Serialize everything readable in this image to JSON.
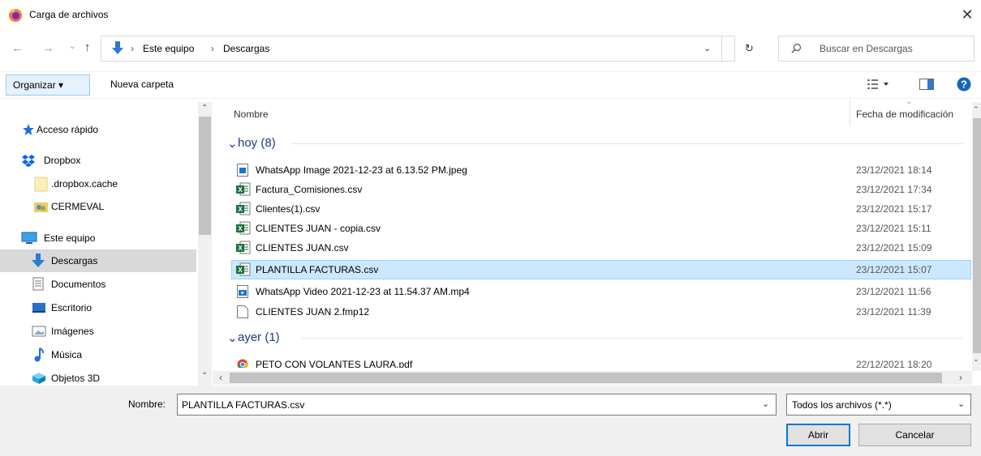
{
  "window": {
    "title": "Carga de archivos"
  },
  "address": {
    "parts": [
      "Este equipo",
      "Descargas"
    ]
  },
  "search": {
    "placeholder": "Buscar en Descargas"
  },
  "toolbar": {
    "organize_label": "Organizar ▾",
    "new_folder_label": "Nueva carpeta"
  },
  "sidebar": {
    "items": [
      {
        "label": "Acceso rápido",
        "icon": "star-icon"
      },
      {
        "label": "Dropbox",
        "icon": "dropbox-icon"
      },
      {
        "label": ".dropbox.cache",
        "icon": "folder-icon"
      },
      {
        "label": "CERMEVAL",
        "icon": "shared-folder-icon"
      },
      {
        "label": "Este equipo",
        "icon": "computer-icon"
      },
      {
        "label": "Descargas",
        "icon": "download-icon",
        "selected": true
      },
      {
        "label": "Documentos",
        "icon": "documents-icon"
      },
      {
        "label": "Escritorio",
        "icon": "desktop-icon"
      },
      {
        "label": "Imágenes",
        "icon": "images-icon"
      },
      {
        "label": "Música",
        "icon": "music-icon"
      },
      {
        "label": "Objetos 3D",
        "icon": "3d-objects-icon"
      }
    ]
  },
  "files": {
    "columns": {
      "name": "Nombre",
      "date": "Fecha de modificación"
    },
    "groups": [
      {
        "label": "hoy (8)",
        "items": [
          {
            "name": "WhatsApp Image 2021-12-23 at 6.13.52 PM.jpeg",
            "date": "23/12/2021 18:14",
            "icon": "image-file-icon"
          },
          {
            "name": "Factura_Comisiones.csv",
            "date": "23/12/2021 17:34",
            "icon": "csv-file-icon"
          },
          {
            "name": "Clientes(1).csv",
            "date": "23/12/2021 15:17",
            "icon": "csv-file-icon"
          },
          {
            "name": "CLIENTES JUAN - copia.csv",
            "date": "23/12/2021 15:11",
            "icon": "csv-file-icon"
          },
          {
            "name": "CLIENTES JUAN.csv",
            "date": "23/12/2021 15:09",
            "icon": "csv-file-icon"
          },
          {
            "name": "PLANTILLA FACTURAS.csv",
            "date": "23/12/2021 15:07",
            "icon": "csv-file-icon",
            "selected": true
          },
          {
            "name": "WhatsApp Video 2021-12-23 at 11.54.37 AM.mp4",
            "date": "23/12/2021 11:56",
            "icon": "video-file-icon"
          },
          {
            "name": "CLIENTES JUAN 2.fmp12",
            "date": "23/12/2021 11:39",
            "icon": "blank-file-icon"
          }
        ]
      },
      {
        "label": "ayer (1)",
        "items": [
          {
            "name": "PETO CON VOLANTES LAURA.pdf",
            "date": "22/12/2021 18:20",
            "icon": "pdf-file-icon"
          }
        ]
      }
    ]
  },
  "footer": {
    "filename_label": "Nombre:",
    "filename_value": "PLANTILLA FACTURAS.csv",
    "filetype_value": "Todos los archivos (*.*)",
    "open_label": "Abrir",
    "cancel_label": "Cancelar"
  },
  "colors": {
    "accent": "#0078d7",
    "selection": "#cce8ff",
    "group_text": "#1e3a8a"
  }
}
